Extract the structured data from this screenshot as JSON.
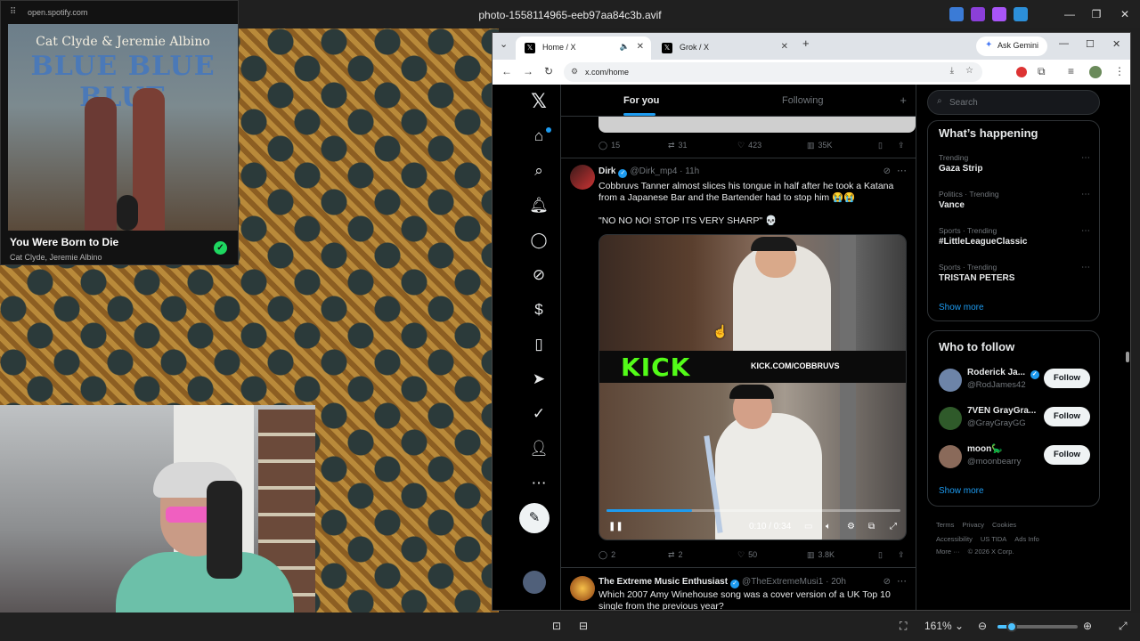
{
  "viewer": {
    "title": "photo-1558114965-eeb97aa84c3b.avif",
    "minimize": "—",
    "restore": "❐",
    "close": "✕",
    "zoom_level": "161%",
    "zoom_fraction": 0.18
  },
  "spotify": {
    "url": "open.spotify.com",
    "album_artist": "Cat Clyde & Jeremie Albino",
    "album_title": "BLUE BLUE BLUE",
    "song": "You Were Born to Die",
    "artists": "Cat Clyde, Jeremie Albino",
    "check_icon": "✓"
  },
  "browser": {
    "tabs": [
      {
        "label": "Home / X",
        "icon": "x-logo-icon"
      },
      {
        "label": "Grok / X",
        "icon": "x-logo-icon"
      }
    ],
    "new_tab": "+",
    "ask_gemini": "Ask Gemini",
    "url": "x.com/home"
  },
  "x": {
    "timeline_tabs": {
      "for_you": "For you",
      "following": "Following"
    },
    "prev_post_stats": {
      "replies": "15",
      "reposts": "31",
      "likes": "423",
      "views": "35K"
    },
    "post1": {
      "name": "Dirk",
      "handle": "@Dirk_mp4",
      "time": "11h",
      "text_line1": "Cobbruvs Tanner almost slices his tongue in half after he took a Katana",
      "text_line2": "from a Japanese Bar and the Bartender had to stop him 😭😭",
      "text_quote": "\"NO NO NO! STOP ITS VERY SHARP\" 💀",
      "video": {
        "kick_logo": "KICK",
        "kick_url": "KICK.COM/COBBRUVS",
        "time": "0:10 / 0:34",
        "progress": 0.29
      },
      "stats": {
        "replies": "2",
        "reposts": "2",
        "likes": "50",
        "views": "3.8K"
      }
    },
    "post2": {
      "name": "The Extreme Music Enthusiast",
      "handle": "@TheExtremeMusi1",
      "time": "20h",
      "text_line1": "Which 2007 Amy Winehouse song was a cover version of a UK Top 10",
      "text_line2": "single from the previous year?"
    },
    "search_placeholder": "Search",
    "whats_happening": {
      "title": "What’s happening",
      "trends": [
        {
          "meta": "Trending",
          "name": "Gaza Strip"
        },
        {
          "meta": "Politics · Trending",
          "name": "Vance"
        },
        {
          "meta": "Sports · Trending",
          "name": "#LittleLeagueClassic"
        },
        {
          "meta": "Sports · Trending",
          "name": "TRISTAN PETERS"
        }
      ],
      "show_more": "Show more"
    },
    "who_to_follow": {
      "title": "Who to follow",
      "accounts": [
        {
          "name": "Roderick Ja...",
          "handle": "@RodJames42",
          "verified": true
        },
        {
          "name": "7VEN GrayGra...",
          "handle": "@GrayGrayGG",
          "verified": false
        },
        {
          "name": "moon🦕",
          "handle": "@moonbearry",
          "verified": false
        }
      ],
      "follow_label": "Follow",
      "show_more": "Show more"
    },
    "footer": {
      "line1": [
        "Terms",
        "Privacy",
        "Cookies"
      ],
      "line2": [
        "Accessibility",
        "US TIDA",
        "Ads Info"
      ],
      "line3": [
        "More ···",
        "© 2026 X Corp."
      ]
    }
  }
}
